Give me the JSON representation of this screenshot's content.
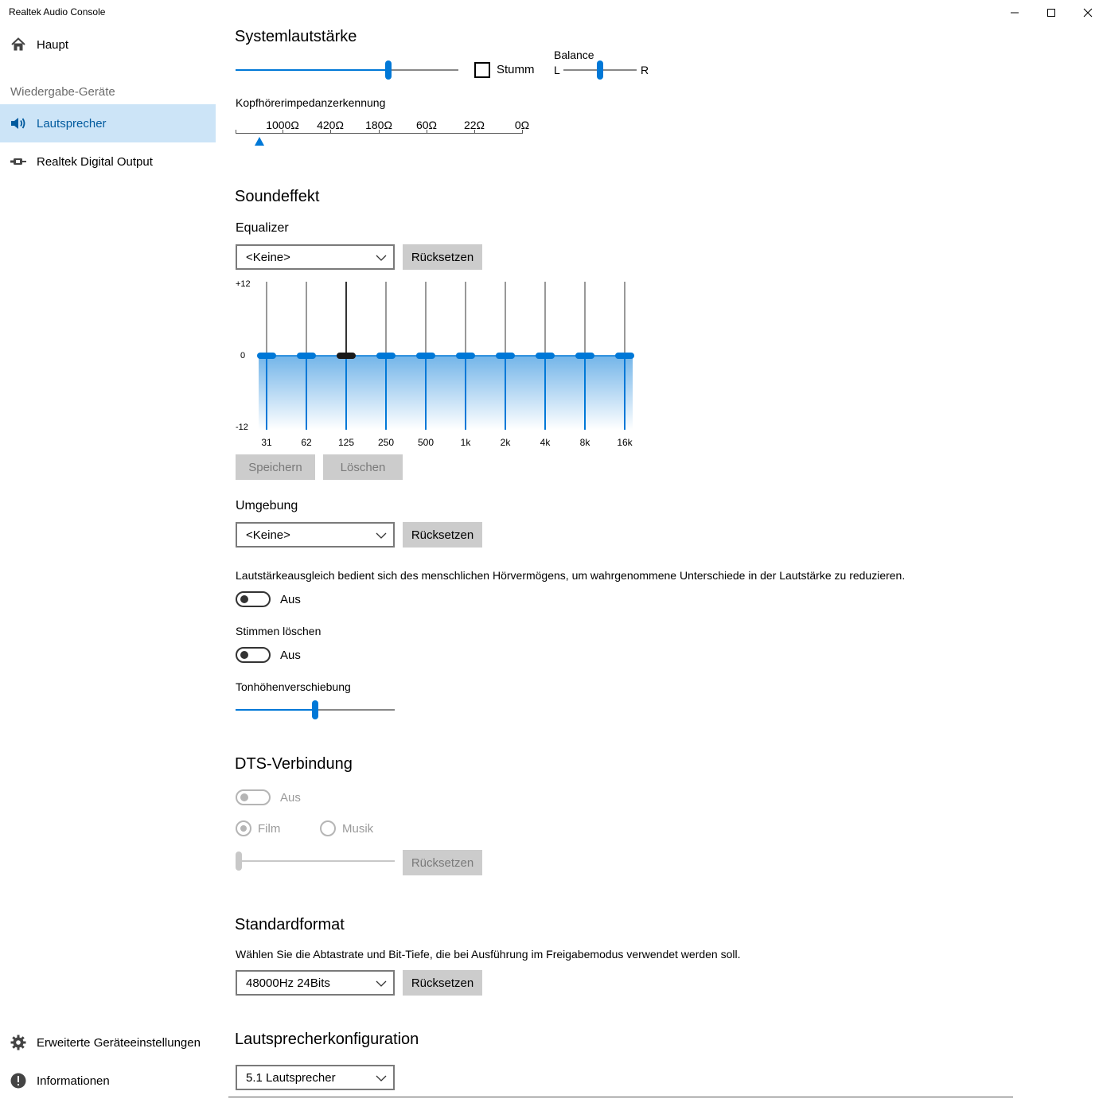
{
  "window": {
    "title": "Realtek Audio Console",
    "controls": {
      "minimize": "minimize-icon",
      "maximize": "maximize-icon",
      "close": "close-icon"
    }
  },
  "sidebar": {
    "home_label": "Haupt",
    "section_label": "Wiedergabe-Geräte",
    "devices": [
      {
        "label": "Lautsprecher",
        "icon": "speaker-icon",
        "selected": true
      },
      {
        "label": "Realtek Digital Output",
        "icon": "digital-output-icon",
        "selected": false
      }
    ],
    "advanced_label": "Erweiterte Geräteeinstellungen",
    "info_label": "Informationen"
  },
  "volume": {
    "heading": "Systemlautstärke",
    "level_fraction": 0.69,
    "mute_label": "Stumm",
    "mute_checked": false,
    "balance_label": "Balance",
    "balance_left": "L",
    "balance_right": "R",
    "balance_fraction": 0.5
  },
  "impedance": {
    "label": "Kopfhörerimpedanzerkennung",
    "ticks": [
      "1000Ω",
      "420Ω",
      "180Ω",
      "60Ω",
      "22Ω",
      "0Ω"
    ]
  },
  "sound_effect": {
    "heading": "Soundeffekt",
    "equalizer_label": "Equalizer",
    "equalizer_value": "<Keine>",
    "reset_label": "Rücksetzen",
    "y_labels": {
      "top": "+12",
      "mid": "0",
      "bottom": "-12"
    },
    "bands": [
      {
        "freq": "31",
        "gain": 0
      },
      {
        "freq": "62",
        "gain": 0
      },
      {
        "freq": "125",
        "gain": 0
      },
      {
        "freq": "250",
        "gain": 0
      },
      {
        "freq": "500",
        "gain": 0
      },
      {
        "freq": "1k",
        "gain": 0
      },
      {
        "freq": "2k",
        "gain": 0
      },
      {
        "freq": "4k",
        "gain": 0
      },
      {
        "freq": "8k",
        "gain": 0
      },
      {
        "freq": "16k",
        "gain": 0
      }
    ],
    "save_label": "Speichern",
    "delete_label": "Löschen",
    "environment_label": "Umgebung",
    "environment_value": "<Keine>",
    "loudness_text": "Lautstärkeausgleich bedient sich des menschlichen Hörvermögens, um wahrgenommene Unterschiede in der Lautstärke zu reduzieren.",
    "loudness_state": "Aus",
    "voice_cancel_label": "Stimmen löschen",
    "voice_cancel_state": "Aus",
    "pitch_label": "Tonhöhenverschiebung",
    "pitch_fraction": 0.5
  },
  "dts": {
    "heading": "DTS-Verbindung",
    "state": "Aus",
    "film_label": "Film",
    "music_label": "Musik",
    "selected_mode": "Film",
    "level_fraction": 0.0,
    "reset_label": "Rücksetzen"
  },
  "default_format": {
    "heading": "Standardformat",
    "description": "Wählen Sie die Abtastrate und Bit-Tiefe, die bei Ausführung im Freigabemodus verwendet werden soll.",
    "value": "48000Hz 24Bits",
    "reset_label": "Rücksetzen"
  },
  "speaker_config": {
    "heading": "Lautsprecherkonfiguration",
    "value": "5.1 Lautsprecher"
  },
  "colors": {
    "accent": "#0078d7",
    "selected_bg": "#cce4f7",
    "button_bg": "#cccccc"
  }
}
